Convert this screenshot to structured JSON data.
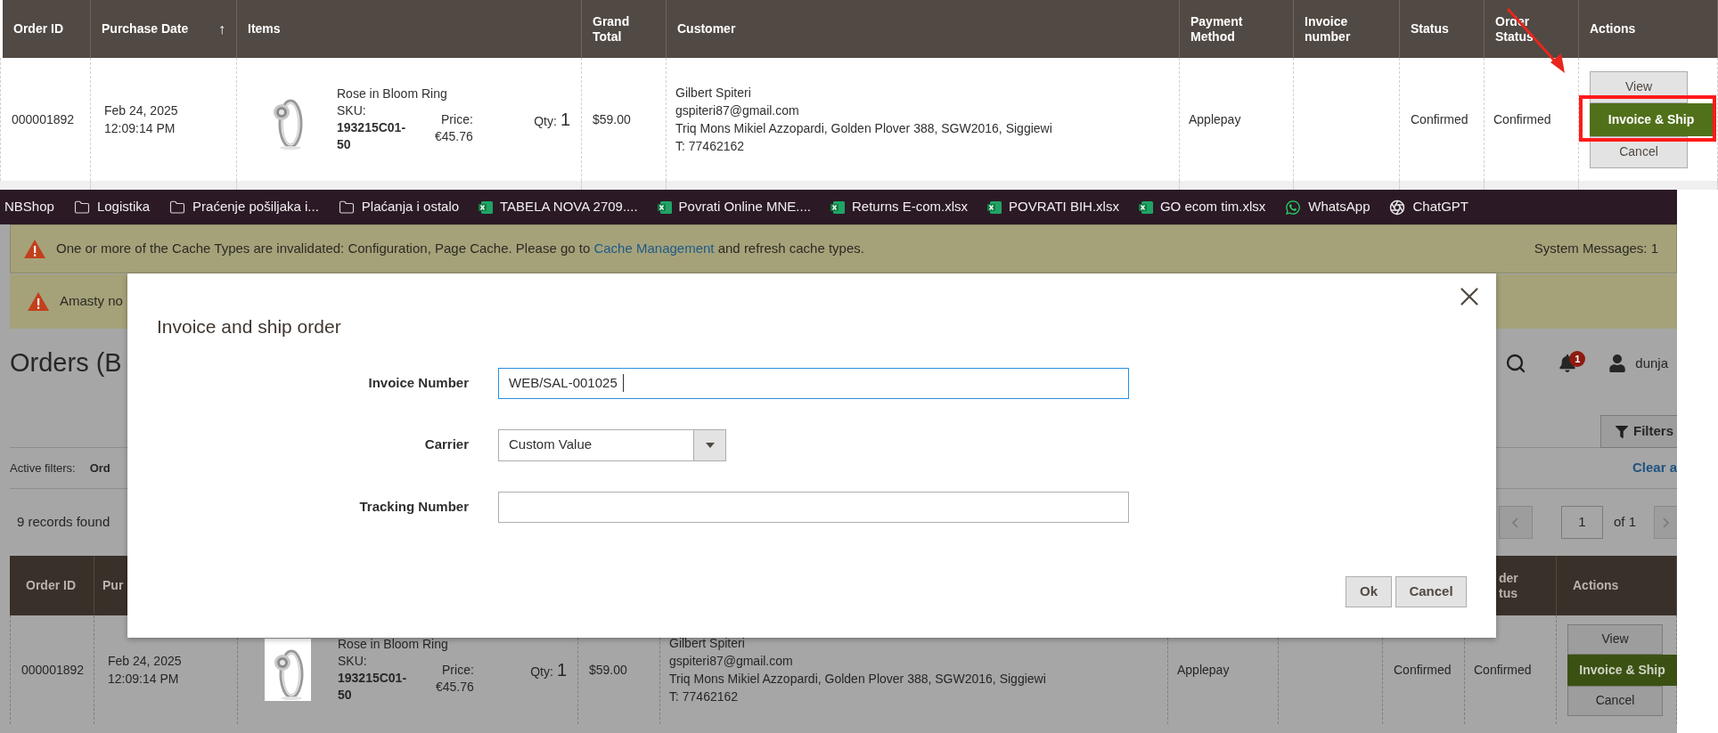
{
  "top_grid": {
    "columns": [
      {
        "label": "Order ID"
      },
      {
        "label": "Purchase Date",
        "sort": "↑"
      },
      {
        "label": "Items"
      },
      {
        "label": "Grand Total"
      },
      {
        "label": "Customer"
      },
      {
        "label": "Payment Method"
      },
      {
        "label": "Invoice number"
      },
      {
        "label": "Status"
      },
      {
        "label": "Order Status"
      },
      {
        "label": "Actions"
      }
    ],
    "rows": [
      {
        "order_id": "000001892",
        "purchase_date": "Feb 24, 2025",
        "purchase_time": "12:09:14 PM",
        "item": {
          "name": "Rose in Bloom Ring",
          "sku_label": "SKU:",
          "sku": "193215C01-50",
          "price_label": "Price:",
          "price": "€45.76",
          "qty_label": "Qty:",
          "qty": "1"
        },
        "grand_total": "$59.00",
        "customer": {
          "name": "Gilbert Spiteri",
          "email": "gspiteri87@gmail.com",
          "address": "Triq Mons Mikiel Azzopardi, Golden Plover 388, SGW2016, Siggiewi",
          "phone": "T: 77462162"
        },
        "payment_method": "Applepay",
        "status": "Confirmed",
        "order_status": "Confirmed",
        "actions": [
          {
            "label": "View",
            "kind": "secondary"
          },
          {
            "label": "Invoice & Ship",
            "kind": "primary"
          },
          {
            "label": "Cancel",
            "kind": "secondary"
          }
        ]
      }
    ],
    "annotation": {
      "kind": "arrow-and-frame"
    }
  },
  "bookmarks": [
    {
      "kind": "text",
      "label": "NBShop"
    },
    {
      "kind": "folder",
      "label": "Logistika"
    },
    {
      "kind": "folder",
      "label": "Praćenje pošiljaka i..."
    },
    {
      "kind": "folder",
      "label": "Plaćanja i ostalo"
    },
    {
      "kind": "excel",
      "label": "TABELA NOVA 2709...."
    },
    {
      "kind": "excel",
      "label": "Povrati Online MNE...."
    },
    {
      "kind": "excel",
      "label": "Returns E-com.xlsx"
    },
    {
      "kind": "excel",
      "label": "POVRATI BIH.xlsx"
    },
    {
      "kind": "excel",
      "label": "GO ecom tim.xlsx"
    },
    {
      "kind": "whatsapp",
      "label": "WhatsApp"
    },
    {
      "kind": "chatgpt",
      "label": "ChatGPT"
    }
  ],
  "system_messages": {
    "messages": [
      {
        "before": "One or more of the Cache Types are invalidated: Configuration, Page Cache. Please go to ",
        "link": "Cache Management",
        "after": " and refresh cache types."
      },
      {
        "before": "Amasty no"
      }
    ],
    "count_label": "System Messages: 1"
  },
  "page": {
    "title": "Orders (B",
    "notification_count": "1",
    "user": "dunja",
    "filters_button": "Filters",
    "active_filters_label": "Active filters:",
    "active_filter": "Ord",
    "clear_all": "Clear a",
    "records_found": "9 records found",
    "page_number": "1",
    "page_total": "of 1"
  },
  "bottom_grid": {
    "columns": [
      {
        "label": "Order ID"
      },
      {
        "label": "Pur"
      },
      {
        "label": "der tus"
      },
      {
        "label": "Actions"
      }
    ],
    "rows": [
      {
        "order_id": "000001892",
        "purchase_date": "Feb 24, 2025",
        "purchase_time": "12:09:14 PM",
        "item": {
          "name": "Rose in Bloom Ring",
          "sku_label": "SKU:",
          "sku": "193215C01-50",
          "price_label": "Price:",
          "price": "€45.76",
          "qty_label": "Qty:",
          "qty": "1"
        },
        "grand_total": "$59.00",
        "customer": {
          "name": "Gilbert Spiteri",
          "email": "gspiteri87@gmail.com",
          "address": "Triq Mons Mikiel Azzopardi, Golden Plover 388, SGW2016, Siggiewi",
          "phone": "T: 77462162"
        },
        "payment_method": "Applepay",
        "status": "Confirmed",
        "order_status": "Confirmed",
        "actions": [
          {
            "label": "View",
            "kind": "secondary"
          },
          {
            "label": "Invoice & Ship",
            "kind": "primary"
          },
          {
            "label": "Cancel",
            "kind": "secondary"
          }
        ]
      }
    ]
  },
  "modal": {
    "title": "Invoice and ship order",
    "fields": [
      {
        "label": "Invoice Number",
        "kind": "text",
        "value": "WEB/SAL-001025",
        "focused": true
      },
      {
        "label": "Carrier",
        "kind": "select",
        "value": "Custom Value",
        "focused": false
      },
      {
        "label": "Tracking Number",
        "kind": "text",
        "focused": false
      }
    ],
    "buttons": [
      "Ok",
      "Cancel"
    ]
  }
}
